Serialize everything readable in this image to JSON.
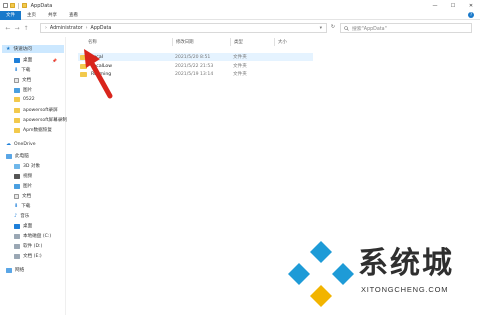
{
  "window": {
    "title": "AppData",
    "controls": {
      "minimize": "—",
      "maximize": "☐",
      "close": "✕"
    }
  },
  "ribbon": {
    "tabs": [
      "文件",
      "主页",
      "共享",
      "查看"
    ],
    "help": "?"
  },
  "address": {
    "path": [
      "Administrator",
      "AppData"
    ],
    "dropdown": "▾",
    "refresh": "↻"
  },
  "search": {
    "placeholder": "搜索\"AppData\""
  },
  "sidebar": {
    "quick_access": "快速访问",
    "quick_items": [
      "桌面",
      "下载",
      "文档",
      "图片",
      "0522",
      "apowersoft录屏",
      "apowersoft屏幕录制",
      "Apm数据恢复"
    ],
    "onedrive": "OneDrive",
    "this_pc": "此电脑",
    "pc_items": [
      "3D 对象",
      "视频",
      "图片",
      "文档",
      "下载",
      "音乐",
      "桌面",
      "本地磁盘 (C:)",
      "软件 (D:)",
      "文档 (E:)"
    ],
    "network": "网络"
  },
  "columns": {
    "name": "名称",
    "date": "修改日期",
    "type": "类型",
    "size": "大小"
  },
  "files": [
    {
      "name": "Local",
      "date": "2021/5/20 8:51",
      "type": "文件夹"
    },
    {
      "name": "LocalLow",
      "date": "2021/5/22 21:53",
      "type": "文件夹"
    },
    {
      "name": "Roaming",
      "date": "2021/5/19 13:14",
      "type": "文件夹"
    }
  ],
  "watermark": {
    "title": "系统城",
    "url": "XITONGCHENG.COM"
  },
  "colors": {
    "accent": "#1979ca",
    "folder": "#f2c94c",
    "arrow": "#d9251c",
    "wm_blue": "#1e9bd7"
  }
}
